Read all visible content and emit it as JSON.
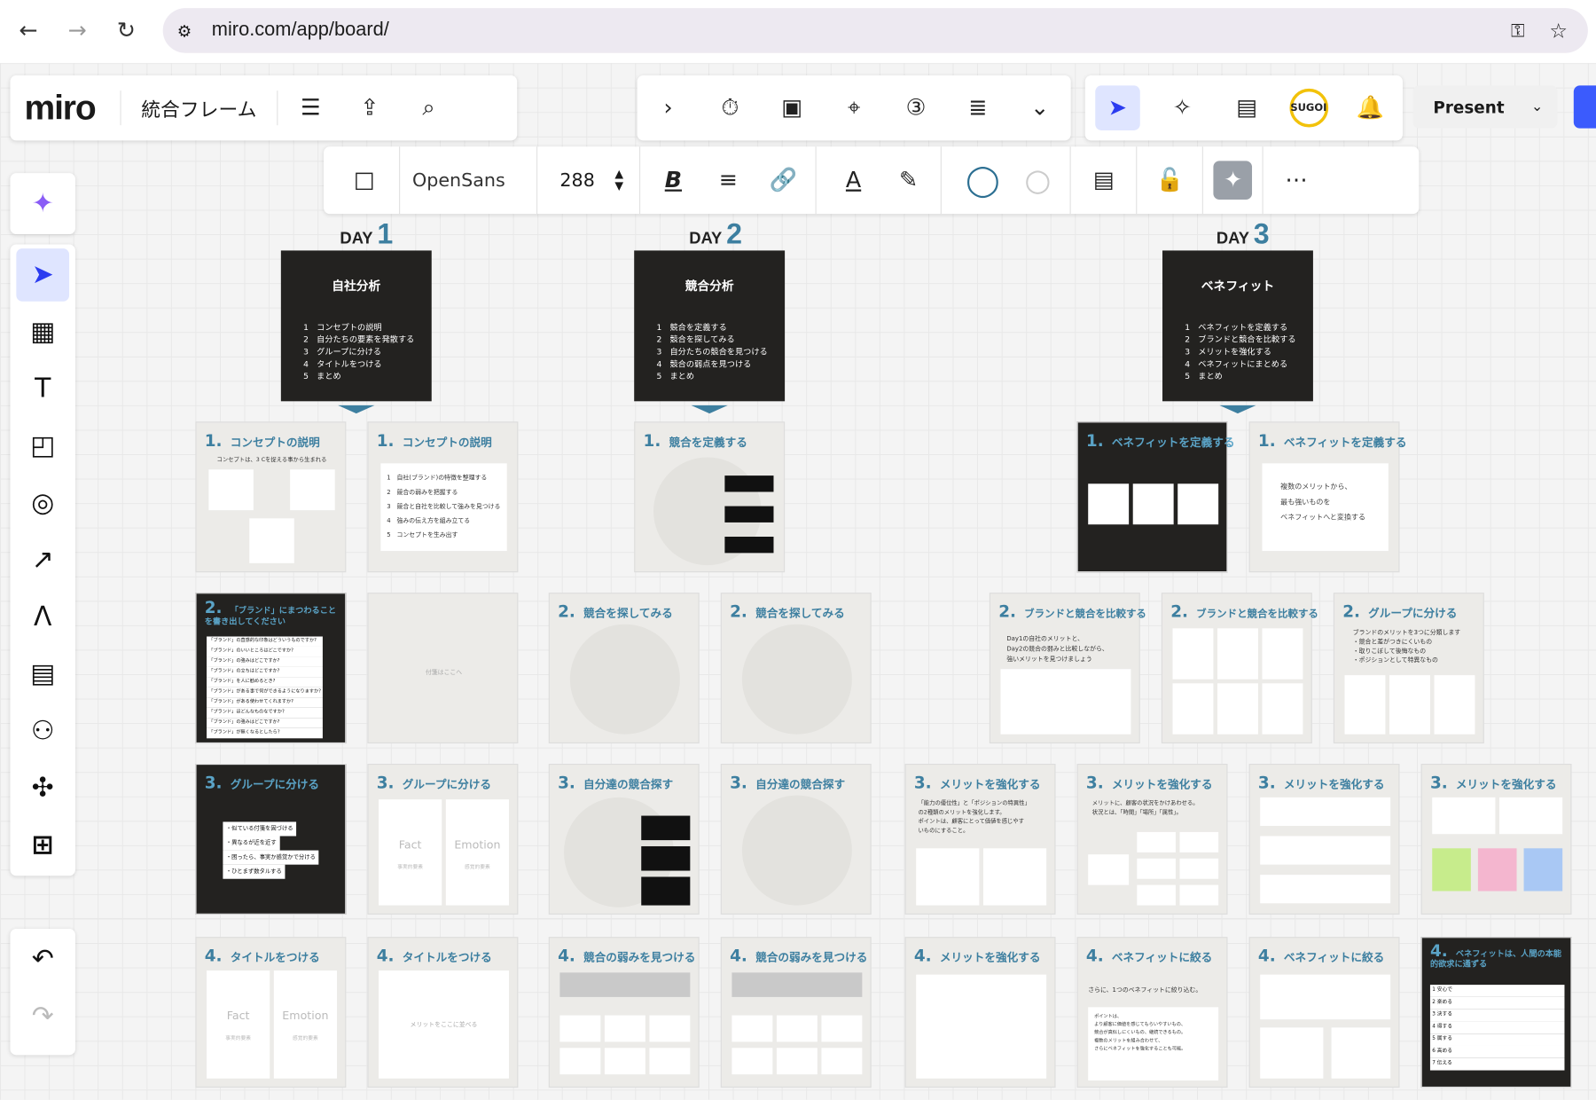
{
  "browser": {
    "url": "miro.com/app/board/"
  },
  "board": {
    "logo": "miro",
    "name": "統合フレーム",
    "present": "Present"
  },
  "format": {
    "font": "OpenSans",
    "size": "288"
  },
  "days": [
    {
      "label": "DAY",
      "num": "1"
    },
    {
      "label": "DAY",
      "num": "2"
    },
    {
      "label": "DAY",
      "num": "3"
    }
  ],
  "titles": [
    {
      "title": "自社分析",
      "items": [
        "1　コンセプトの説明",
        "2　自分たちの要素を発散する",
        "3　グループに分ける",
        "4　タイトルをつける",
        "5　まとめ"
      ]
    },
    {
      "title": "競合分析",
      "items": [
        "1　競合を定義する",
        "2　競合を探してみる",
        "3　自分たちの競合を見つける",
        "4　競合の弱点を見つける",
        "5　まとめ"
      ]
    },
    {
      "title": "ベネフィット",
      "items": [
        "1　ベネフィットを定義する",
        "2　ブランドと競合を比較する",
        "3　メリットを強化する",
        "4　ベネフィットにまとめる",
        "5　まとめ"
      ]
    }
  ],
  "frames": {
    "r1": [
      {
        "n": "1.",
        "t": "コンセプトの説明",
        "sub": "コンセプトは、3 Cを捉える事から生まれる"
      },
      {
        "n": "1.",
        "t": "コンセプトの説明",
        "lines": [
          "1　自社(ブランド)の特徴を整理する",
          "2　競合の弱みを把握する",
          "3　競合と自社を比較して強みを見つける",
          "4　強みの伝え方を組み立てる",
          "5　コンセプトを生み出す"
        ]
      },
      {
        "n": "1.",
        "t": "競合を定義する"
      },
      {
        "n": "1.",
        "t": "ベネフィットを定義する"
      },
      {
        "n": "1.",
        "t": "ベネフィットを定義する",
        "lines": [
          "複数のメリットから、",
          "最も強いものを",
          "ベネフィットへと変換する"
        ]
      }
    ],
    "r2": [
      {
        "n": "2.",
        "t": "「ブランド」にまつわることを書き出してください"
      },
      {
        "n": "",
        "t": "",
        "note": "付箋はここへ"
      },
      {
        "n": "2.",
        "t": "競合を探してみる"
      },
      {
        "n": "2.",
        "t": "競合を探してみる"
      },
      {
        "n": "2.",
        "t": "ブランドと競合を比較する",
        "lines": [
          "Day1の自社のメリットと、",
          "Day2の競合の弱みと比較しながら、",
          "強いメリットを見つけましょう"
        ]
      },
      {
        "n": "2.",
        "t": "ブランドと競合を比較する"
      },
      {
        "n": "2.",
        "t": "グループに分ける",
        "lines": [
          "ブランドのメリットを3つに分類します",
          "・競合と差がつきにくいもの",
          "・取りこぼして後悔なもの",
          "・ポジションとして特異なもの"
        ]
      }
    ],
    "r3": [
      {
        "n": "3.",
        "t": "グループに分ける",
        "lines": [
          "・似ている付箋を固づける",
          "・異なるが近を近す",
          "・困ったら、事実か感覚かで分ける",
          "・ひとまず数タルする"
        ]
      },
      {
        "n": "3.",
        "t": "グループに分ける",
        "fact": "Fact",
        "emotion": "Emotion",
        "fs": "事実的要素",
        "es": "感覚的要素"
      },
      {
        "n": "3.",
        "t": "自分達の競合探す"
      },
      {
        "n": "3.",
        "t": "自分達の競合探す"
      },
      {
        "n": "3.",
        "t": "メリットを強化する",
        "lines": [
          "「能力の優位性」と「ポジションの特異性」",
          "の2種類のメリットを強化します。",
          "ポイントは、顧客にとって価値を感じやす",
          "いものにすること。"
        ]
      },
      {
        "n": "3.",
        "t": "メリットを強化する",
        "lines": [
          "メリットに、顧客の状況をかけあわせる。",
          "状況とは、「時間」「場所」「属性」。"
        ]
      },
      {
        "n": "3.",
        "t": "メリットを強化する"
      },
      {
        "n": "3.",
        "t": "メリットを強化する"
      }
    ],
    "r4": [
      {
        "n": "4.",
        "t": "タイトルをつける",
        "fact": "Fact",
        "emotion": "Emotion",
        "fs": "事実的要素",
        "es": "感覚的要素"
      },
      {
        "n": "4.",
        "t": "タイトルをつける",
        "note": "メリットをここに並べる"
      },
      {
        "n": "4.",
        "t": "競合の弱みを見つける"
      },
      {
        "n": "4.",
        "t": "競合の弱みを見つける"
      },
      {
        "n": "4.",
        "t": "メリットを強化する"
      },
      {
        "n": "4.",
        "t": "ベネフィットに絞る",
        "lines": [
          "さらに、1つのベネフィットに絞り込む。",
          "ポイントは、",
          "より顧客に価値を感じてもらいやすいもの、",
          "競合が真似しにくいもの、継続できるもの。",
          "複数のメリットを組み合わせて、",
          "さらにベネフィットを強化することも可能。"
        ]
      },
      {
        "n": "4.",
        "t": "ベネフィットに絞る"
      },
      {
        "n": "4.",
        "t": "ベネフィットは、人間の本能的欲求に通ずる",
        "lines": [
          "1 安心で",
          "2 楽める",
          "3 決する",
          "4 得する",
          "5 属する",
          "6 高める",
          "7 伝える"
        ]
      }
    ]
  },
  "dark_list_r2": [
    "「ブランド」の直感的な印象はどういうものですか?",
    "「ブランド」のいいところはどこですか?",
    "「ブランド」の強みはどこですか?",
    "「ブランド」の立ちはどこですか?",
    "「ブランド」を人に勧めるとき?",
    "「ブランド」がある事で何ができるようになりますか?",
    "「ブランド」がある使わせてくれますか?",
    "「ブランド」ほどんなものなですか?",
    "「ブランド」の強みはどこですか?",
    "「ブランド」が無くなるとしたら?"
  ]
}
